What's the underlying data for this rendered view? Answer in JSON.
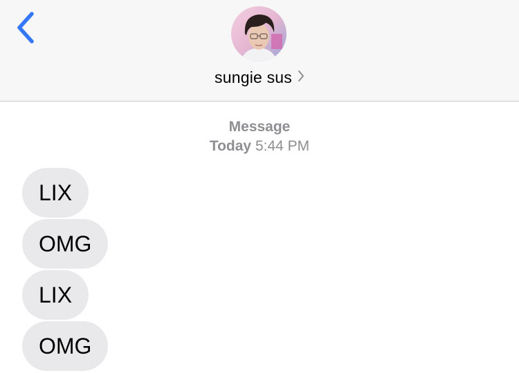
{
  "header": {
    "contact_name": "sungie sus"
  },
  "thread": {
    "service_label": "Message",
    "day_label": "Today",
    "time_label": "5:44 PM"
  },
  "messages": [
    {
      "text": "LIX"
    },
    {
      "text": "OMG"
    },
    {
      "text": "LIX"
    },
    {
      "text": "OMG"
    }
  ],
  "colors": {
    "accent": "#3478f6",
    "header_bg": "#f7f7f7",
    "incoming_bubble": "#e9e9eb",
    "meta_text": "#8e8e93"
  },
  "icons": {
    "back": "chevron-left-icon",
    "contact_detail": "chevron-right-icon"
  }
}
